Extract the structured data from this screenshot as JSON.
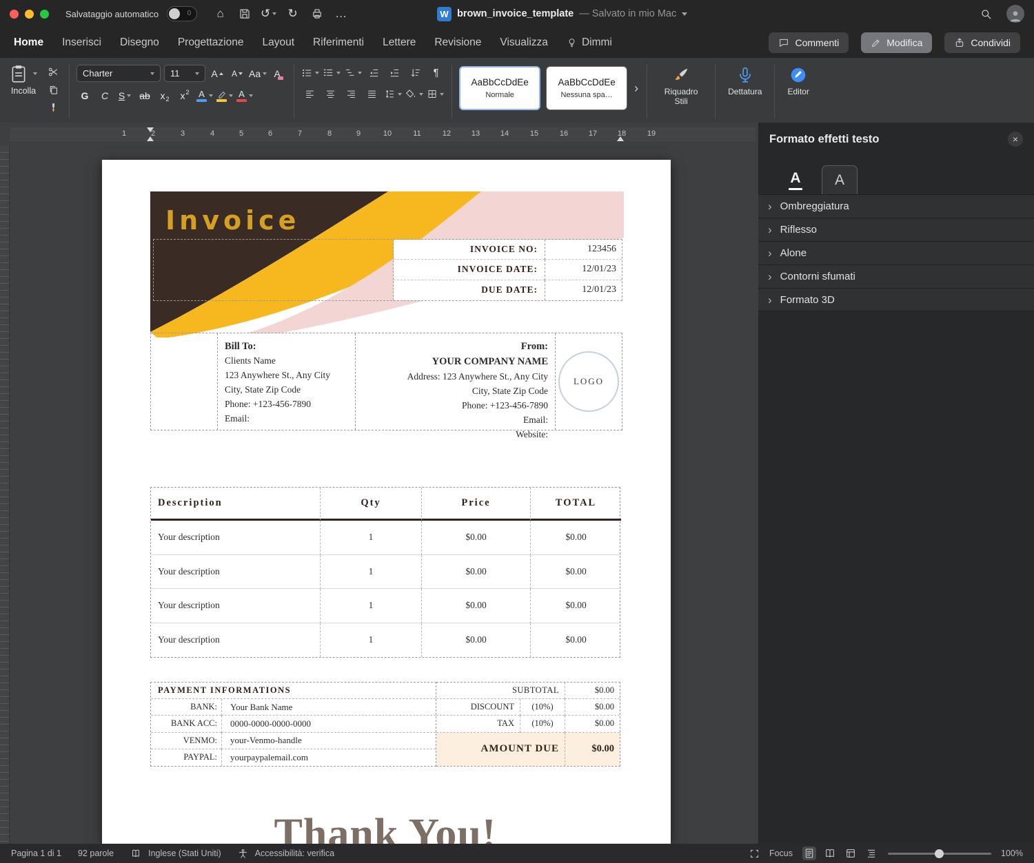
{
  "titlebar": {
    "autosave_label": "Salvataggio automatico",
    "doc_name": "brown_invoice_template",
    "doc_status": "— Salvato in mio Mac"
  },
  "icons": {
    "home": "⌂",
    "undo": "↺",
    "redo": "↻",
    "more": "…",
    "word_logo": "W",
    "close": "×",
    "chevron_right": "›",
    "pilcrow": "¶",
    "bold": "G",
    "italic": "C",
    "underline": "S",
    "strikethrough": "ab",
    "sub_base": "x",
    "sub_small": "2",
    "sup_base": "x",
    "sup_small": "2",
    "font_grow": "A",
    "font_shrink": "A",
    "change_case": "Aa",
    "clear_format": "A",
    "text_effects": "A",
    "font_color": "A",
    "panel_tab_a": "A",
    "toggle_off": "0"
  },
  "menu": {
    "tabs": [
      "Home",
      "Inserisci",
      "Disegno",
      "Progettazione",
      "Layout",
      "Riferimenti",
      "Lettere",
      "Revisione",
      "Visualizza",
      "Dimmi"
    ],
    "comments": "Commenti",
    "edit": "Modifica",
    "share": "Condividi"
  },
  "ribbon": {
    "paste": "Incolla",
    "font_name": "Charter",
    "font_size": "11",
    "style_preview": "AaBbCcDdEe",
    "style_normal": "Normale",
    "style_nospace": "Nessuna spa…",
    "styles_pane": "Riquadro Stili",
    "dictation": "Dettatura",
    "editor": "Editor"
  },
  "ruler": {
    "numbers": [
      "1",
      "2",
      "3",
      "4",
      "5",
      "6",
      "7",
      "8",
      "9",
      "10",
      "11",
      "12",
      "13",
      "14",
      "15",
      "16",
      "17",
      "18",
      "19"
    ]
  },
  "invoice": {
    "title": "Invoice",
    "meta": [
      {
        "label": "INVOICE NO:",
        "value": "123456"
      },
      {
        "label": "INVOICE DATE:",
        "value": "12/01/23"
      },
      {
        "label": "DUE DATE:",
        "value": "12/01/23"
      }
    ],
    "bill_to": {
      "heading": "Bill To:",
      "lines": [
        "Clients Name",
        "123 Anywhere St., Any City",
        "City, State Zip Code",
        "Phone: +123-456-7890",
        "Email:"
      ]
    },
    "from": {
      "heading": "From:",
      "company": "YOUR COMPANY NAME",
      "lines": [
        "Address:  123 Anywhere St., Any City",
        "City, State Zip Code",
        "Phone: +123-456-7890",
        "Email:",
        "Website:"
      ]
    },
    "logo": "LOGO",
    "items": {
      "headers": [
        "Description",
        "Qty",
        "Price",
        "TOTAL"
      ],
      "rows": [
        [
          "Your description",
          "1",
          "$0.00",
          "$0.00"
        ],
        [
          "Your description",
          "1",
          "$0.00",
          "$0.00"
        ],
        [
          "Your description",
          "1",
          "$0.00",
          "$0.00"
        ],
        [
          "Your description",
          "1",
          "$0.00",
          "$0.00"
        ]
      ]
    },
    "payment": {
      "heading": "PAYMENT INFORMATIONS",
      "rows": [
        {
          "label": "BANK:",
          "value": "Your Bank Name"
        },
        {
          "label": "BANK ACC:",
          "value": "0000-0000-0000-0000"
        },
        {
          "label": "VENMO:",
          "value": "your-Venmo-handle"
        },
        {
          "label": "PAYPAL:",
          "value": "yourpaypalemail.com"
        }
      ]
    },
    "totals": {
      "subtotal_label": "SUBTOTAL",
      "subtotal_value": "$0.00",
      "discount_label": "DISCOUNT",
      "discount_pct": "(10%)",
      "discount_value": "$0.00",
      "tax_label": "TAX",
      "tax_pct": "(10%)",
      "tax_value": "$0.00",
      "amount_due_label": "AMOUNT DUE",
      "amount_due_value": "$0.00"
    },
    "thank_you": "Thank You!"
  },
  "panel": {
    "title": "Formato effetti testo",
    "sections": [
      "Ombreggiatura",
      "Riflesso",
      "Alone",
      "Contorni sfumati",
      "Formato 3D"
    ]
  },
  "statusbar": {
    "page_count": "Pagina 1 di 1",
    "word_count": "92 parole",
    "language": "Inglese (Stati Uniti)",
    "accessibility": "Accessibilità: verifica",
    "focus": "Focus",
    "zoom": "100%"
  }
}
